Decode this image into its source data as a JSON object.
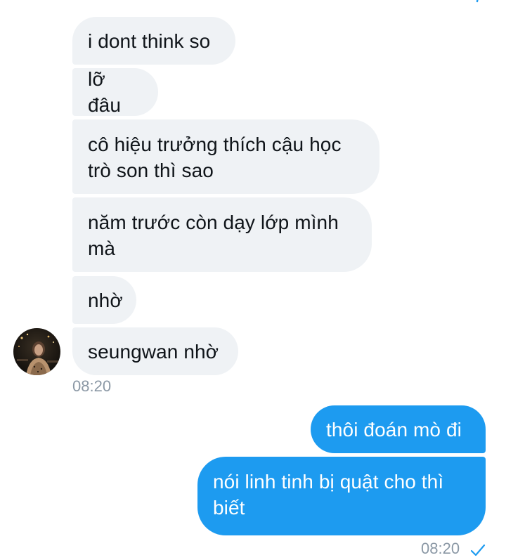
{
  "received_messages": [
    {
      "text": "i dont think so"
    },
    {
      "text": "lỡ đâu"
    },
    {
      "line1": "cô hiệu trưởng thích cậu học",
      "line2": "trò son thì sao"
    },
    {
      "line1": "năm trước còn dạy lớp mình",
      "line2": "mà"
    },
    {
      "text": "nhờ"
    },
    {
      "text": "seungwan nhờ"
    }
  ],
  "received_time": "08:20",
  "sent_messages": [
    {
      "text": "thôi đoán mò đi"
    },
    {
      "line1": "nói linh tinh bị quật cho thì",
      "line2": "biết"
    }
  ],
  "sent_time": "08:20",
  "colors": {
    "received_bubble": "#eff2f5",
    "sent_bubble": "#1d9bf0",
    "timestamp": "#8b98a5",
    "read_check": "#1d9bf0"
  },
  "icons": {
    "read_receipt": "checkmark-icon"
  }
}
